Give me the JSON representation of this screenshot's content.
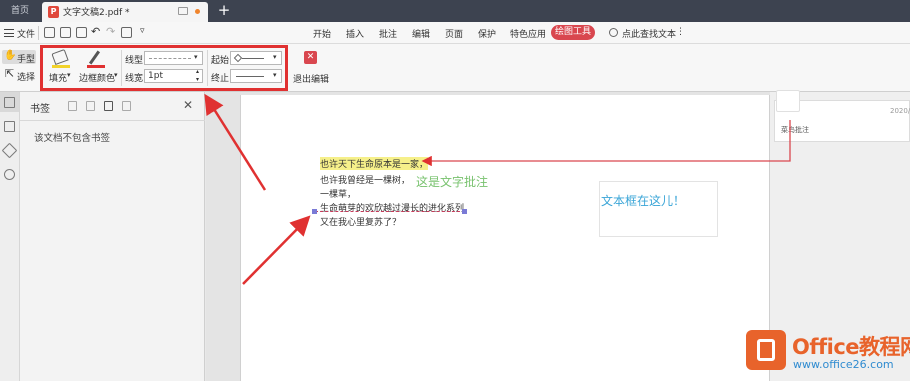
{
  "tabs": {
    "home_label": "首页",
    "doc_title": "文字文稿2.pdf *",
    "new_tab": "+"
  },
  "menu": {
    "file_label": "文件",
    "items": [
      "开始",
      "插入",
      "批注",
      "编辑",
      "页面",
      "保护",
      "特色应用"
    ],
    "active_tab": "绘图工具",
    "search_placeholder": "点此查找文本",
    "more": "⋮"
  },
  "toolbar": {
    "hand_label": "手型",
    "select_label": "选择",
    "fill_label": "填充",
    "border_color_label": "边框颜色",
    "line_type_label": "线型",
    "line_width_label": "线宽",
    "line_width_value": "1pt",
    "start_label": "起始",
    "end_label": "终止",
    "exit_label": "退出编辑"
  },
  "bookmarks": {
    "title": "书签",
    "empty_message": "该文档不包含书签",
    "close": "✕"
  },
  "document": {
    "poem_lines": [
      "也许天下生命原本是一家，",
      "也许我曾经是一棵树，",
      "一棵草，",
      "生命萌芽的欢欣越过漫长的进化系列，",
      "又在我心里复苏了？"
    ],
    "text_annotation": "这是文字批注",
    "textbox_content": "文本框在这儿！"
  },
  "comment_pane": {
    "date": "2020/",
    "author": "菜鸟批注"
  },
  "watermark": {
    "title": "Office教程网",
    "url": "www.office26.com"
  },
  "colors": {
    "tabbar_bg": "#3d4350",
    "active_tab_bg": "#d9474f",
    "highlight_arrow": "#e03131",
    "highlight_fill": "#f6f08a",
    "annotation_text": "#78c26e",
    "textbox_text": "#3aa5d7",
    "brand_orange": "#e8632b"
  }
}
